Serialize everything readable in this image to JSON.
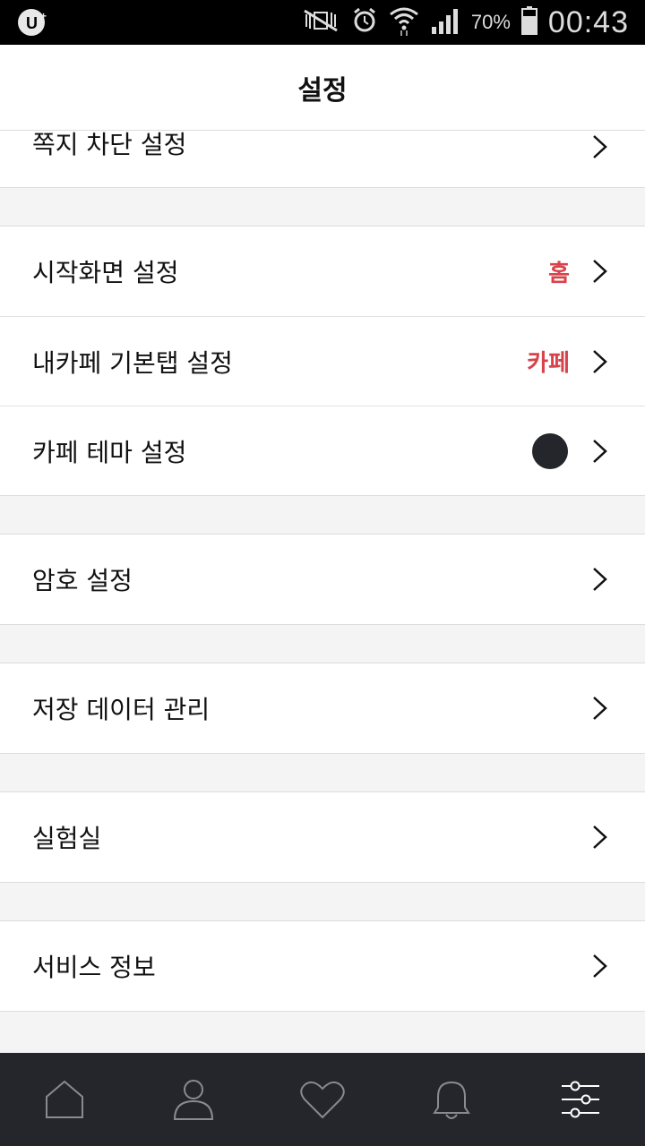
{
  "status_bar": {
    "carrier_logo": "uplus-logo",
    "icons": [
      "mute-icon",
      "alarm-icon",
      "wifi-icon",
      "signal-icon",
      "battery-icon"
    ],
    "battery": "70%",
    "time": "00:43"
  },
  "header": {
    "title": "설정"
  },
  "groups": [
    {
      "items": [
        {
          "label": "쪽지 차단 설정"
        }
      ]
    },
    {
      "items": [
        {
          "label": "시작화면 설정",
          "value": "홈"
        },
        {
          "label": "내카페 기본탭 설정",
          "value": "카페"
        },
        {
          "label": "카페 테마 설정",
          "theme_color": "#25262b"
        }
      ]
    },
    {
      "items": [
        {
          "label": "암호 설정"
        }
      ]
    },
    {
      "items": [
        {
          "label": "저장 데이터 관리"
        }
      ]
    },
    {
      "items": [
        {
          "label": "실험실"
        }
      ]
    },
    {
      "items": [
        {
          "label": "서비스 정보"
        }
      ]
    }
  ],
  "bottom_nav": {
    "items": [
      "home-icon",
      "profile-icon",
      "favorites-icon",
      "notifications-icon",
      "settings-icon"
    ],
    "active": "settings-icon"
  },
  "colors": {
    "accent": "#d8434b",
    "nav_bg": "#25262b",
    "page_bg": "#f4f4f4"
  }
}
